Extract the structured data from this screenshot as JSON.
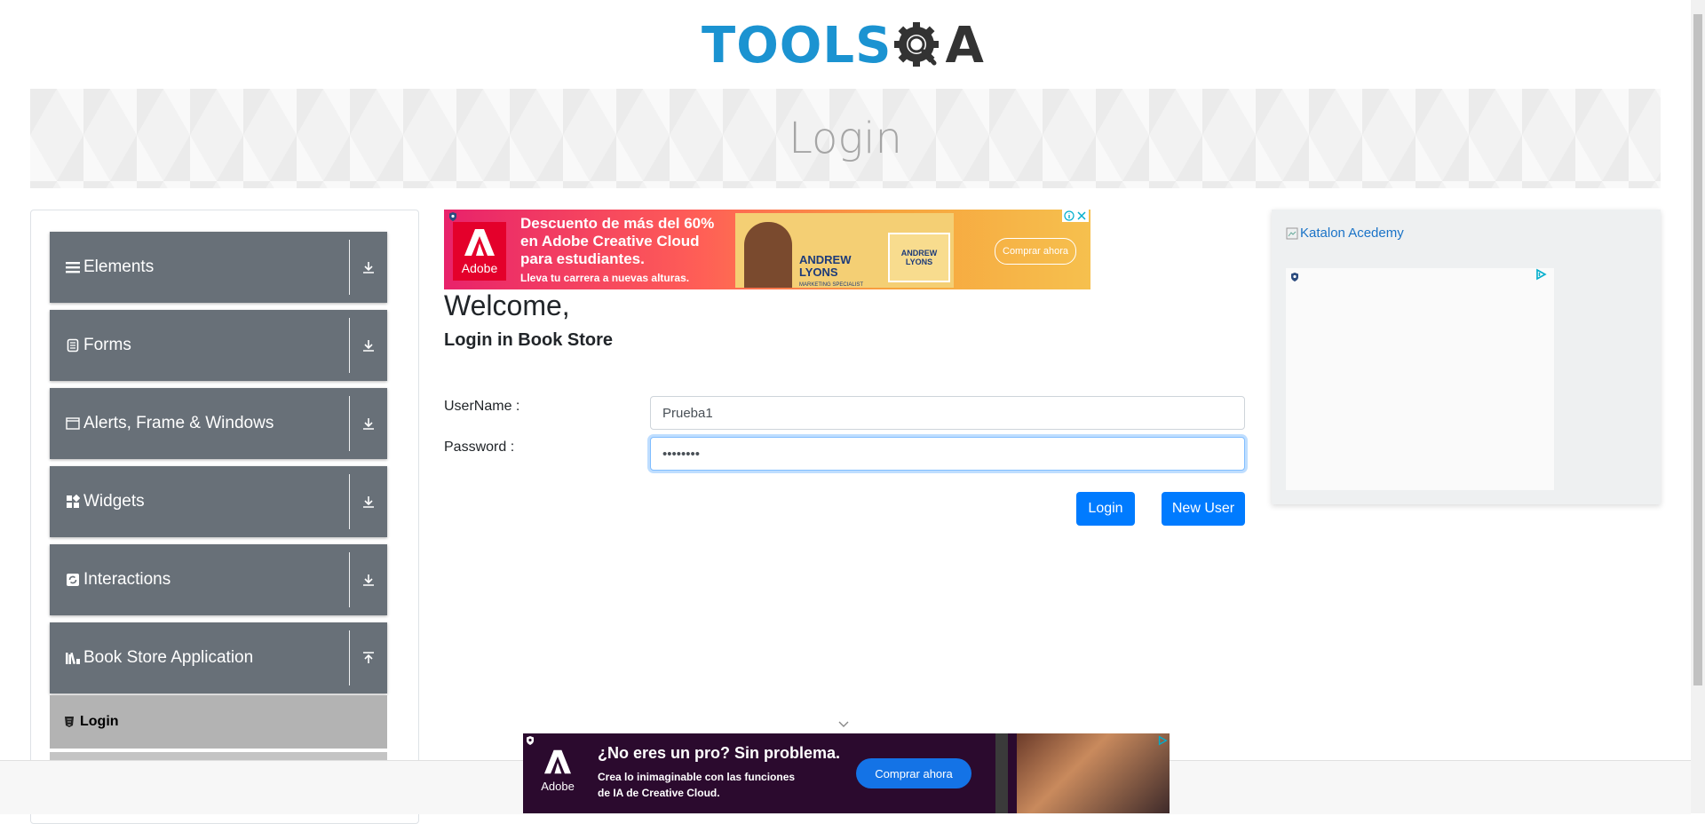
{
  "logo": {
    "part1": "TOOLS",
    "part2": "A"
  },
  "banner": {
    "title": "Login"
  },
  "sidebar": {
    "groups": [
      {
        "label": "Elements",
        "icon": "hamburger-icon",
        "state": "collapsed"
      },
      {
        "label": "Forms",
        "icon": "document-icon",
        "state": "collapsed"
      },
      {
        "label": "Alerts, Frame & Windows",
        "icon": "window-icon",
        "state": "collapsed"
      },
      {
        "label": "Widgets",
        "icon": "widgets-icon",
        "state": "collapsed"
      },
      {
        "label": "Interactions",
        "icon": "refresh-icon",
        "state": "collapsed"
      },
      {
        "label": "Book Store Application",
        "icon": "books-icon",
        "state": "expanded"
      }
    ],
    "active_item": {
      "label": "Login",
      "icon": "html-icon"
    }
  },
  "ad_top": {
    "brand": "Adobe",
    "headline": "Descuento de más del 60% en Adobe Creative Cloud para estudiantes.",
    "line1": "Descuento de más del 60%",
    "line2": "en Adobe Creative Cloud",
    "line3": "para estudiantes.",
    "sub": "Lleva tu carrera a nuevas alturas.",
    "name1": "ANDREW",
    "name2": "LYONS",
    "role": "MARKETING SPECIALIST",
    "name_card": "ANDREW LYONS",
    "cta": "Comprar ahora"
  },
  "main": {
    "welcome": "Welcome,",
    "subtitle": "Login in Book Store",
    "username_label": "UserName :",
    "username_value": "Prueba1",
    "password_label": "Password :",
    "password_value": "••••••••",
    "login_button": "Login",
    "new_user_button": "New User"
  },
  "right_ad": {
    "link_text": "Katalon Acedemy"
  },
  "bottom_ad": {
    "brand": "Adobe",
    "headline": "¿No eres un pro? Sin problema.",
    "line1": "Crea lo inimaginable con las funciones",
    "line2": "de IA de Creative Cloud.",
    "cta": "Comprar ahora"
  },
  "colors": {
    "accent": "#007bff",
    "sidebar_group": "#687078",
    "sidebar_active": "#b3b3b3",
    "logo_blue": "#1b93d1"
  }
}
